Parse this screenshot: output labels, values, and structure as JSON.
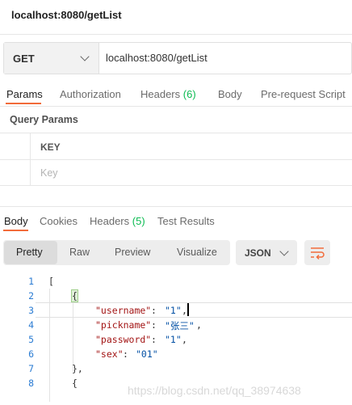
{
  "window": {
    "title": "localhost:8080/getList"
  },
  "request": {
    "method": "GET",
    "url": "localhost:8080/getList"
  },
  "request_tabs": [
    {
      "label": "Params"
    },
    {
      "label": "Authorization"
    },
    {
      "label": "Headers",
      "count": "(6)"
    },
    {
      "label": "Body"
    },
    {
      "label": "Pre-request Script"
    }
  ],
  "query_params": {
    "title": "Query Params",
    "column_key": "KEY",
    "placeholder": "Key"
  },
  "response_tabs": [
    {
      "label": "Body"
    },
    {
      "label": "Cookies"
    },
    {
      "label": "Headers",
      "count": "(5)"
    },
    {
      "label": "Test Results"
    }
  ],
  "view_modes": [
    "Pretty",
    "Raw",
    "Preview",
    "Visualize"
  ],
  "format": {
    "selected": "JSON"
  },
  "code_lines": {
    "n": [
      "1",
      "2",
      "3",
      "4",
      "5",
      "6",
      "7",
      "8"
    ],
    "l1": "[",
    "l2": "{",
    "l3k": "\"username\"",
    "l3v": "\"1\"",
    "l4k": "\"pickname\"",
    "l4v": "\"张三\"",
    "l5k": "\"password\"",
    "l5v": "\"1\"",
    "l6k": "\"sex\"",
    "l6v": "\"01\"",
    "l7": "},",
    "l8": "{"
  },
  "watermark": "https://blog.csdn.net/qq_38974638",
  "colors": {
    "accent": "#f26b3a",
    "count_green": "#0cbb52",
    "key": "#a31515",
    "string": "#0451a5",
    "line_number": "#2b7cd3"
  },
  "icons": {
    "method_dropdown": "chevron-down-icon",
    "format_dropdown": "chevron-down-icon",
    "wrap": "wrap-lines-icon"
  }
}
